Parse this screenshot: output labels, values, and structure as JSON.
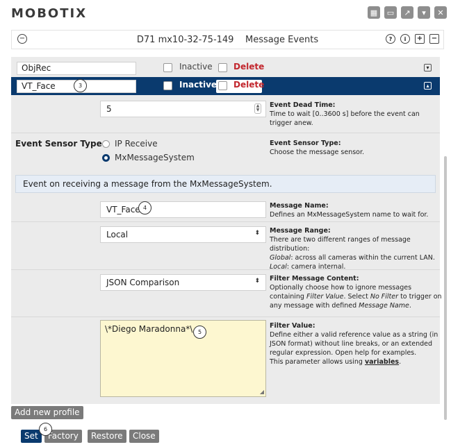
{
  "brand": {
    "name": "MOBOTIX"
  },
  "window_icons": [
    "grid-icon",
    "window-icon",
    "external-icon",
    "chevron-icon",
    "close-icon"
  ],
  "header": {
    "device": "D71 mx10-32-75-149",
    "section": "Message Events",
    "collapse_icon": "minus-circle-icon",
    "help_icons": [
      "question-icon",
      "info-icon",
      "plus-square-icon",
      "minus-square-icon"
    ]
  },
  "profiles": [
    {
      "name": "ObjRec",
      "inactive_label": "Inactive",
      "delete_label": "Delete",
      "toggle": "expand"
    },
    {
      "name": "VT_Face",
      "inactive_label": "Inactive",
      "delete_label": "Delete",
      "toggle": "collapse"
    }
  ],
  "dead_time": {
    "value": "5",
    "help_title": "Event Dead Time",
    "help_text": "Time to wait [0..3600 s] before the event can trigger anew."
  },
  "sensor_type": {
    "label": "Event Sensor Type",
    "options": [
      "IP Receive",
      "MxMessageSystem"
    ],
    "selected": "MxMessageSystem",
    "help_title": "Event Sensor Type",
    "help_text": "Choose the message sensor."
  },
  "info_banner": "Event on receiving a message from the MxMessageSystem.",
  "message_name": {
    "value": "VT_Face",
    "help_title": "Message Name",
    "help_text": "Defines an MxMessageSystem name to wait for."
  },
  "message_range": {
    "value": "Local",
    "help_title": "Message Range",
    "help_text_1": "There are two different ranges of message distribution:",
    "help_global_term": "Global",
    "help_global_text": ": across all cameras within the current LAN.",
    "help_local_term": "Local",
    "help_local_text": ": camera internal."
  },
  "filter_content": {
    "value": "JSON Comparison",
    "help_title": "Filter Message Content",
    "help_text_1": "Optionally choose how to ignore messages containing",
    "help_filter_value": "Filter Value",
    "help_text_2": ". Select",
    "help_no_filter": "No Filter",
    "help_text_3": "to trigger on any message with defined",
    "help_message_name": "Message Name",
    "help_text_4": "."
  },
  "filter_value": {
    "value": "\\*Diego Maradonna*\\",
    "help_title": "Filter Value",
    "help_text": "Define either a valid reference value as a string (in JSON format) without line breaks, or an extended regular expression. Open help for examples.",
    "help_vars_prefix": "This parameter allows using",
    "help_vars_link": "variables",
    "help_vars_suffix": "."
  },
  "badges": [
    "3",
    "4",
    "5",
    "6"
  ],
  "buttons": {
    "add_profile": "Add new profile",
    "set": "Set",
    "factory": "Factory",
    "restore": "Restore",
    "close": "Close"
  }
}
